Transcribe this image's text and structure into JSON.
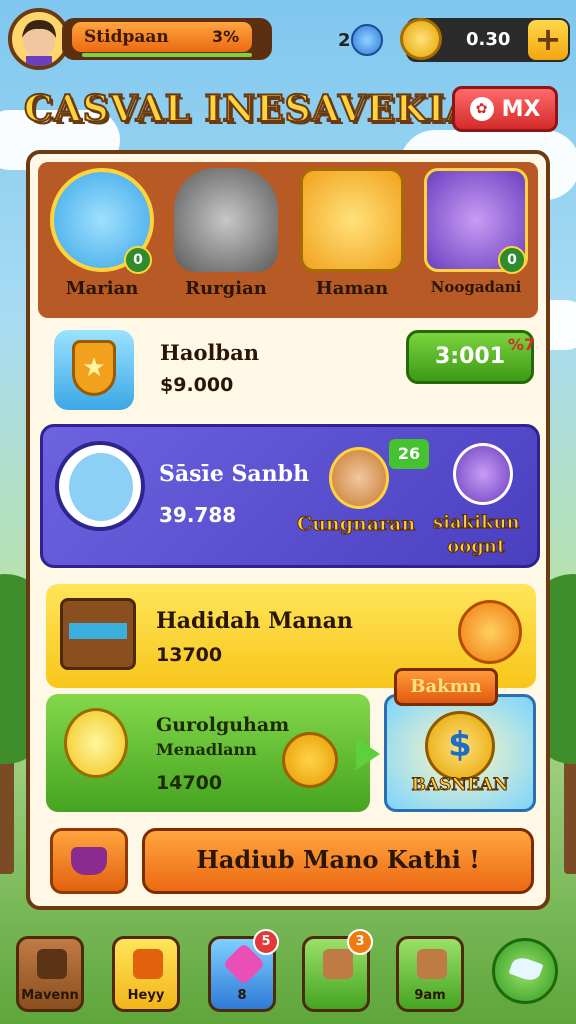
{
  "header": {
    "player_name": "Stidpaan",
    "player_percent": "3%",
    "gem_count": "2",
    "coin_value": "0.30",
    "plus_label": "+"
  },
  "title": "CASVAL INESAVEKIA",
  "mx_button": {
    "label": "MX"
  },
  "heroes": [
    {
      "label": "Marian",
      "badge": "0"
    },
    {
      "label": "Rurgian",
      "badge": ""
    },
    {
      "label": "Haman",
      "badge": ""
    },
    {
      "label": "Noogadani",
      "badge": "0"
    }
  ],
  "store_row": {
    "title": "Haolban",
    "price": "$9.000",
    "button": "3:001",
    "tag": "%7"
  },
  "blue_row": {
    "title": "Sāsīe Sanbh",
    "value": "39.788",
    "badge": "26",
    "caption_left": "Cungnaran",
    "caption_right_line1": "siakikun",
    "caption_right_line2": "oognt"
  },
  "yellow_row": {
    "title": "Hadidah Manan",
    "value": "13700"
  },
  "green_row": {
    "title": "Gurolguham",
    "subtitle": "Menadlann",
    "value": "14700"
  },
  "bonus_card": {
    "ribbon": "Bakmn",
    "label": "BASNEAN",
    "coin_symbol": "$"
  },
  "cta": {
    "label": "Hadiub Mano Kathi !"
  },
  "nav": [
    {
      "label": "Mavenn",
      "badge": ""
    },
    {
      "label": "Heyy",
      "badge": ""
    },
    {
      "label": "8",
      "badge": "5"
    },
    {
      "label": "",
      "badge": "3"
    },
    {
      "label": "9am",
      "badge": ""
    }
  ],
  "colors": {
    "accent_orange": "#ec6a12",
    "panel_bg": "#fff8e6",
    "blue_row": "#5148cc",
    "green_button": "#3d9a16",
    "title_yellow": "#ffd43b"
  }
}
